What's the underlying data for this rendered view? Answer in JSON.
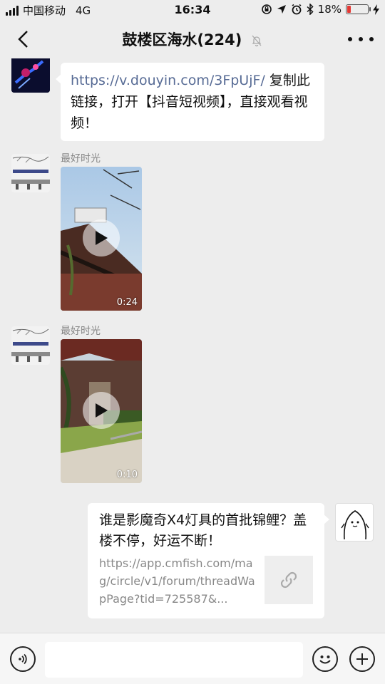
{
  "status_bar": {
    "carrier": "中国移动",
    "network": "4G",
    "time": "16:34",
    "battery_percent": "18%",
    "battery_level": 0.18
  },
  "nav": {
    "title": "鼓楼区海水(224)",
    "icons": {
      "back": "chevron-left-icon",
      "mute": "bell-slash-icon",
      "more": "more-dots-icon"
    }
  },
  "messages": [
    {
      "type": "text",
      "link": "https://v.douyin.com/3FpUjF/",
      "text": " 复制此链接，打开【抖音短视频】，直接观看视频！"
    },
    {
      "type": "video",
      "sender": "最好时光",
      "duration": "0:24"
    },
    {
      "type": "video",
      "sender": "最好时光",
      "duration": "0:10"
    },
    {
      "type": "link-card",
      "title": "谁是影魔奇X4灯具的首批锦鲤？盖楼不停，好运不断！",
      "description": "https://app.cmfish.com/mag/circle/v1/forum/threadWapPage?tid=725587&...",
      "thumb_icon": "link-icon"
    }
  ],
  "input_bar": {
    "placeholder": "",
    "icons": {
      "voice": "voice-icon",
      "emoji": "emoji-icon",
      "add": "plus-icon"
    }
  },
  "colors": {
    "background": "#ededed",
    "link": "#576b95",
    "battery_low": "#e53935"
  }
}
